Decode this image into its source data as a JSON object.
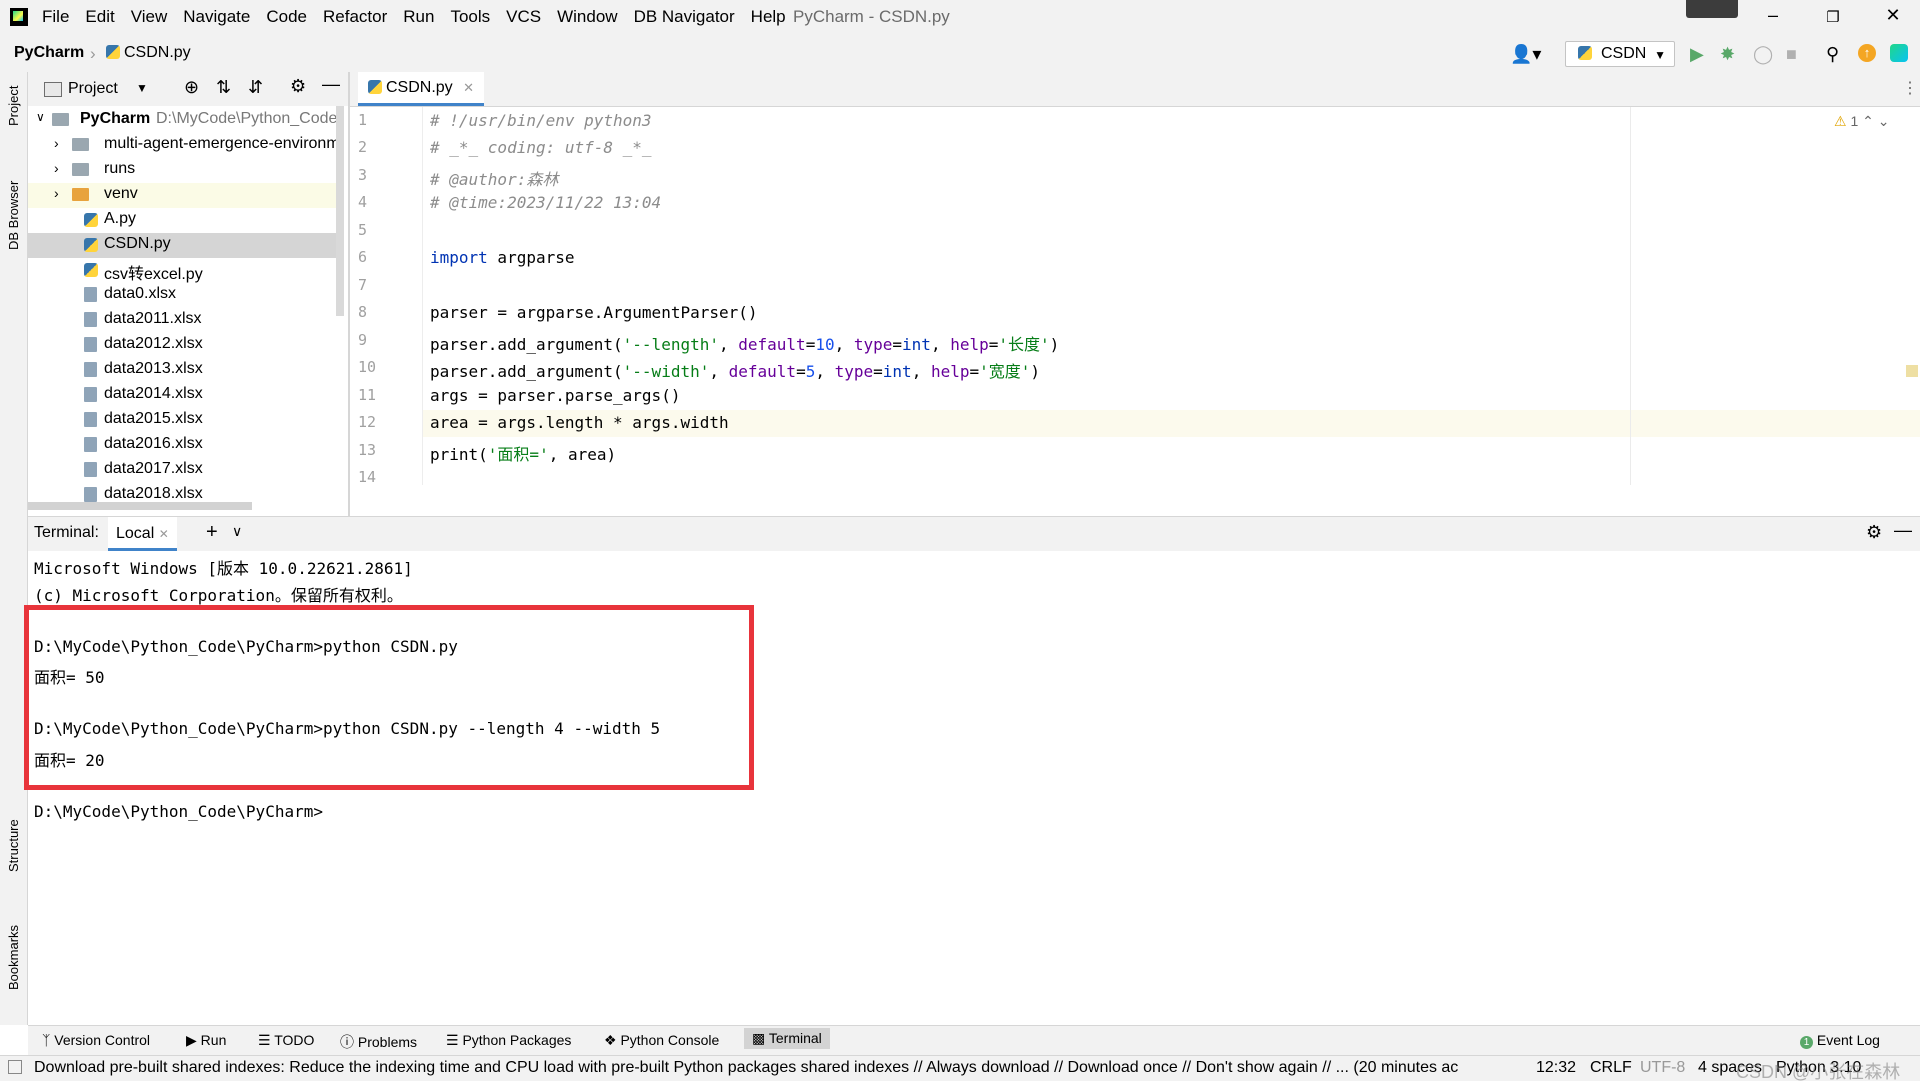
{
  "menubar": {
    "items": [
      "File",
      "Edit",
      "View",
      "Navigate",
      "Code",
      "Refactor",
      "Run",
      "Tools",
      "VCS",
      "Window",
      "DB Navigator",
      "Help"
    ],
    "window_title": "PyCharm - CSDN.py"
  },
  "navbar": {
    "project": "PyCharm",
    "file": "CSDN.py",
    "run_config": "CSDN"
  },
  "left_stripe": {
    "tabs": [
      "Project",
      "DB Browser",
      "Structure",
      "Bookmarks"
    ]
  },
  "project_panel": {
    "header": "Project",
    "root_name": "PyCharm",
    "root_path": "D:\\MyCode\\Python_Code\\",
    "items": [
      {
        "label": "multi-agent-emergence-environm",
        "type": "folder"
      },
      {
        "label": "runs",
        "type": "folder"
      },
      {
        "label": "venv",
        "type": "folder-orange"
      },
      {
        "label": "A.py",
        "type": "py"
      },
      {
        "label": "CSDN.py",
        "type": "py"
      },
      {
        "label": "csv转excel.py",
        "type": "py"
      },
      {
        "label": "data0.xlsx",
        "type": "file"
      },
      {
        "label": "data2011.xlsx",
        "type": "file"
      },
      {
        "label": "data2012.xlsx",
        "type": "file"
      },
      {
        "label": "data2013.xlsx",
        "type": "file"
      },
      {
        "label": "data2014.xlsx",
        "type": "file"
      },
      {
        "label": "data2015.xlsx",
        "type": "file"
      },
      {
        "label": "data2016.xlsx",
        "type": "file"
      },
      {
        "label": "data2017.xlsx",
        "type": "file"
      },
      {
        "label": "data2018.xlsx",
        "type": "file"
      }
    ]
  },
  "editor": {
    "tab_label": "CSDN.py",
    "inspection": "1",
    "line_numbers": [
      "1",
      "2",
      "3",
      "4",
      "5",
      "6",
      "7",
      "8",
      "9",
      "10",
      "11",
      "12",
      "13",
      "14"
    ],
    "lines": {
      "l1": "# !/usr/bin/env python3",
      "l2": "# _*_ coding: utf-8 _*_",
      "l3": "# @author:森林",
      "l4": "# @time:2023/11/22 13:04",
      "l6_kw": "import",
      "l6_rest": " argparse",
      "l8": "parser = argparse.ArgumentParser()",
      "l9_a": "parser.add_argument(",
      "l9_s1": "'--length'",
      "l9_b": ", ",
      "l9_p1": "default",
      "l9_c": "=",
      "l9_n": "10",
      "l9_d": ", ",
      "l9_p2": "type",
      "l9_e": "=",
      "l9_k": "int",
      "l9_f": ", ",
      "l9_p3": "help",
      "l9_g": "=",
      "l9_s2": "'长度'",
      "l9_h": ")",
      "l10_a": "parser.add_argument(",
      "l10_s1": "'--width'",
      "l10_b": ", ",
      "l10_p1": "default",
      "l10_c": "=",
      "l10_n": "5",
      "l10_d": ", ",
      "l10_p2": "type",
      "l10_e": "=",
      "l10_k": "int",
      "l10_f": ", ",
      "l10_p3": "help",
      "l10_g": "=",
      "l10_s2": "'宽度'",
      "l10_h": ")",
      "l11": "args = parser.parse_args()",
      "l12": "area = args.length * args.width",
      "l13_a": "print(",
      "l13_s": "'面积='",
      "l13_b": ", area)"
    }
  },
  "terminal": {
    "label": "Terminal:",
    "tab": "Local",
    "lines": [
      "Microsoft Windows [版本 10.0.22621.2861]",
      "(c) Microsoft Corporation。保留所有权利。",
      "",
      "D:\\MyCode\\Python_Code\\PyCharm>python CSDN.py",
      "面积= 50",
      "",
      "D:\\MyCode\\Python_Code\\PyCharm>python CSDN.py --length 4 --width 5",
      "面积= 20",
      "",
      "D:\\MyCode\\Python_Code\\PyCharm>"
    ]
  },
  "bottom_tools": {
    "items": [
      "Version Control",
      "Run",
      "TODO",
      "Problems",
      "Python Packages",
      "Python Console",
      "Terminal"
    ],
    "event_log": "Event Log"
  },
  "statusbar": {
    "message": "Download pre-built shared indexes: Reduce the indexing time and CPU load with pre-built Python packages shared indexes // Always download // Download once // Don't show again // ... (20 minutes ac",
    "position": "12:32",
    "line_sep": "CRLF",
    "encoding": "UTF-8",
    "indent": "4 spaces",
    "interpreter": "Python 3.10",
    "watermark": "CSDN @小张在森林"
  },
  "colors": {
    "accent": "#4083c9",
    "highlight_box": "#e8343b",
    "keyword": "#0033b3",
    "string": "#067d17",
    "number": "#1750eb",
    "param": "#660099",
    "comment": "#8c8c8c"
  }
}
